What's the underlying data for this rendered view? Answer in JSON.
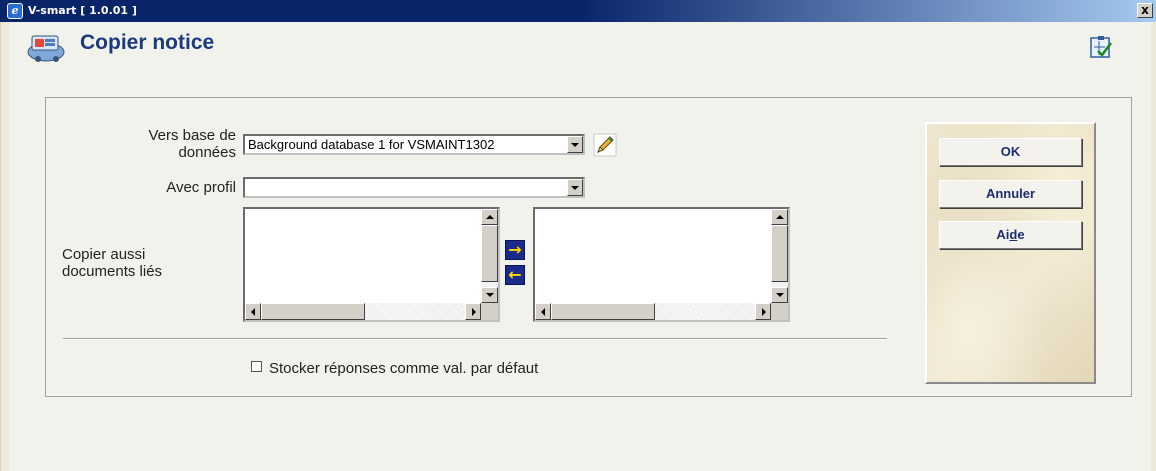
{
  "window": {
    "title": "V-smart [ 1.0.01 ]",
    "close_glyph": "x"
  },
  "page": {
    "title": "Copier notice"
  },
  "form": {
    "database_label_line1": "Vers base de",
    "database_label_line2": "données",
    "database_value": "Background database 1 for VSMAINT1302",
    "profile_label": "Avec profil",
    "profile_value": "",
    "linked_label_line1": "Copier aussi",
    "linked_label_line2": "documents liés",
    "move_right_glyph": "→",
    "move_left_glyph": "←",
    "store_default_label": "Stocker réponses comme val. par défaut",
    "store_default_checked": false
  },
  "buttons": {
    "ok": "OK",
    "cancel": "Annuler",
    "help_prefix": "Ai",
    "help_accel": "d",
    "help_suffix": "e"
  },
  "icons": {
    "app": "ie-icon",
    "page": "copy-record-icon",
    "edit": "pencil-icon",
    "tools": "checklist-icon"
  }
}
